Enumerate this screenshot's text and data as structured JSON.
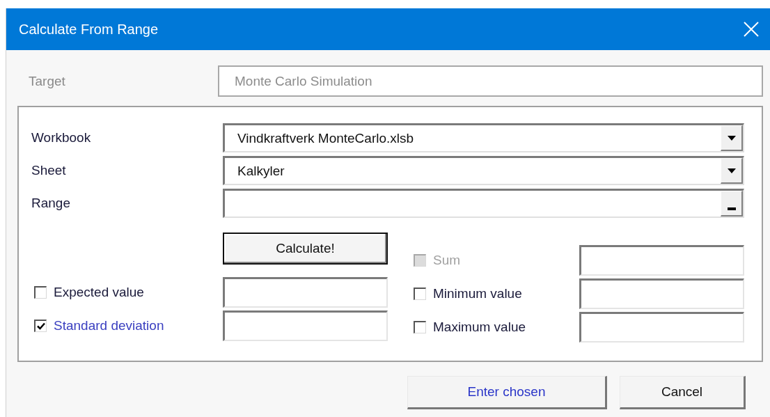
{
  "window": {
    "title": "Calculate From Range"
  },
  "target": {
    "label": "Target",
    "value": "Monte Carlo Simulation",
    "disabled": true
  },
  "inputs": [
    {
      "label": "Workbook",
      "kind": "dropdown",
      "value": "Vindkraftverk MonteCarlo.xlsb"
    },
    {
      "label": "Sheet",
      "kind": "dropdown",
      "value": "Kalkyler"
    },
    {
      "label": "Range",
      "kind": "picker"
    }
  ],
  "calculate_button": "Calculate!",
  "statistics_left": [
    {
      "label": "Expected value",
      "checked": false,
      "disabled": false
    },
    {
      "label": "Standard deviation",
      "checked": true,
      "disabled": false
    }
  ],
  "statistics_right": [
    {
      "label": "Sum",
      "checked": false,
      "disabled": true
    },
    {
      "label": "Minimum value",
      "checked": false,
      "disabled": false
    },
    {
      "label": "Maximum value",
      "checked": false,
      "disabled": false
    }
  ],
  "buttons": [
    {
      "label": "Enter chosen",
      "default": true
    },
    {
      "label": "Cancel",
      "default": false
    }
  ]
}
